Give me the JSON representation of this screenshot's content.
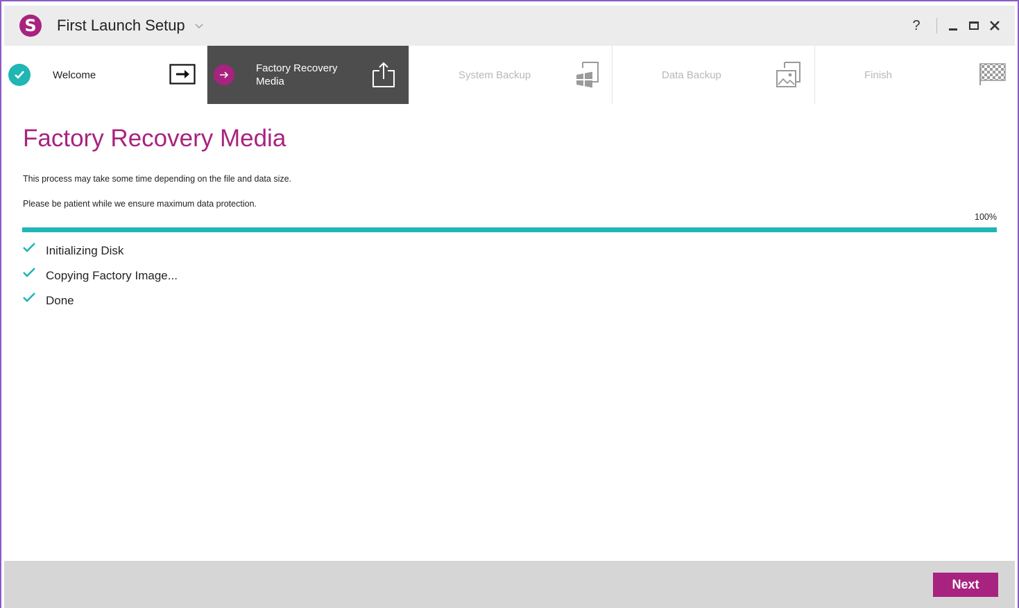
{
  "app": {
    "title": "First Launch Setup",
    "logo_letter": "S"
  },
  "window_controls": {
    "help_label": "?"
  },
  "steps": [
    {
      "label": "Welcome",
      "state": "done",
      "icon": "enter-arrow-icon"
    },
    {
      "label_line1": "Factory Recovery",
      "label_line2": "Media",
      "state": "active",
      "icon": "upload-box-icon"
    },
    {
      "label": "System Backup",
      "state": "pending",
      "icon": "windows-backup-icon"
    },
    {
      "label": "Data Backup",
      "state": "pending",
      "icon": "image-backup-icon"
    },
    {
      "label": "Finish",
      "state": "pending",
      "icon": "checkered-flag-icon"
    }
  ],
  "main": {
    "title": "Factory Recovery Media",
    "description_1": "This process may take some time depending on the file and data size.",
    "description_2": "Please be patient while we ensure maximum data protection.",
    "progress_percent_label": "100%",
    "progress_value": 1.0,
    "tasks": [
      {
        "label": "Initializing Disk",
        "done": true
      },
      {
        "label": "Copying Factory Image...",
        "done": true
      },
      {
        "label": "Done",
        "done": true
      }
    ]
  },
  "footer": {
    "next_label": "Next"
  },
  "colors": {
    "accent": "#a8237f",
    "teal": "#1fb6b3",
    "active_step_bg": "#4d4d4d",
    "footer_bg": "#d6d6d6"
  }
}
